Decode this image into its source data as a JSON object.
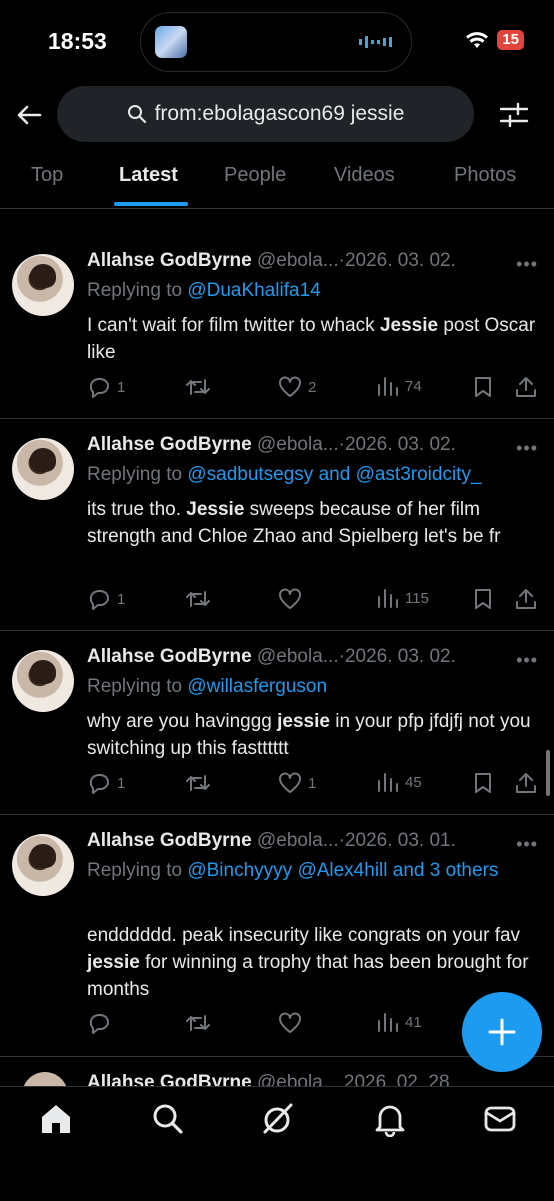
{
  "status": {
    "time": "18:53",
    "battery": "15"
  },
  "search": {
    "query": "from:ebolagascon69 jessie"
  },
  "tabs": [
    "Top",
    "Latest",
    "People",
    "Videos",
    "Photos"
  ],
  "tweets": [
    {
      "name": "Allahse GodByrne",
      "handle": "@ebola...",
      "dot": "·",
      "date": "2026. 03. 02.",
      "replying_prefix": "Replying to ",
      "replying_to": "@DuaKhalifa14",
      "text_parts": [
        "I can't wait for film twitter to whack ",
        "Jessie",
        " post Oscar like"
      ],
      "replies": "1",
      "retweets": "",
      "likes": "2",
      "views": "74"
    },
    {
      "name": "Allahse GodByrne",
      "handle": "@ebola...",
      "dot": "·",
      "date": "2026. 03. 02.",
      "replying_prefix": "Replying to ",
      "replying_to": "@sadbutsegsy and @ast3roidcity_",
      "text_parts": [
        "its true tho. ",
        "Jessie",
        " sweeps because of her film strength and Chloe Zhao and Spielberg let's be fr"
      ],
      "replies": "1",
      "retweets": "",
      "likes": "",
      "views": "115"
    },
    {
      "name": "Allahse GodByrne",
      "handle": "@ebola...",
      "dot": "·",
      "date": "2026. 03. 02.",
      "replying_prefix": "Replying to ",
      "replying_to": "@willasferguson",
      "text_parts": [
        "why are you havinggg ",
        "jessie",
        " in your pfp jfdjfj not you switching up this fastttttt"
      ],
      "replies": "1",
      "retweets": "",
      "likes": "1",
      "views": "45"
    },
    {
      "name": "Allahse GodByrne",
      "handle": "@ebola...",
      "dot": "·",
      "date": "2026. 03. 01.",
      "replying_prefix": "Replying to ",
      "replying_to": "@Binchyyyy @Alex4hill and 3 others",
      "text_parts": [
        "endddddd. peak insecurity like congrats on your fav ",
        "jessie",
        " for winning a trophy that has been brought for months"
      ],
      "replies": "",
      "retweets": "",
      "likes": "",
      "views": "41"
    }
  ],
  "partial_tweet": {
    "name": "Allahse GodByrne",
    "handle": "@ebola...",
    "date": "2026. 02. 28."
  },
  "icons": [
    "back-arrow-icon",
    "search-icon",
    "filter-icon",
    "reply-icon",
    "retweet-icon",
    "like-icon",
    "views-icon",
    "bookmark-icon",
    "share-icon",
    "compose-icon",
    "home-icon",
    "explore-icon",
    "grok-icon",
    "notifications-icon",
    "messages-icon"
  ],
  "colors": {
    "accent": "#1d9bf0",
    "muted": "#71767b",
    "text": "#e7e9ea",
    "bg": "#000000",
    "battery": "#e0443a"
  }
}
